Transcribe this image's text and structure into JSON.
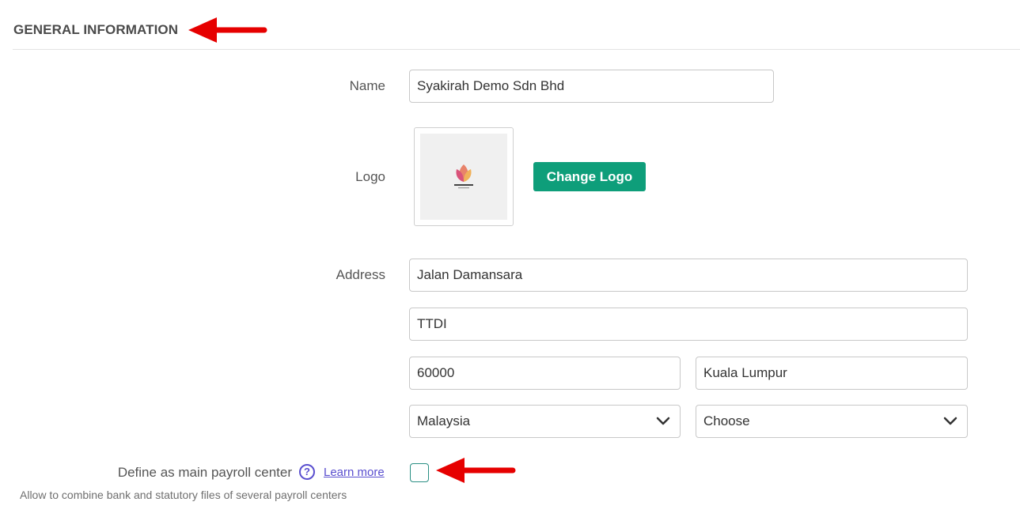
{
  "section": {
    "title": "GENERAL INFORMATION"
  },
  "form": {
    "name_label": "Name",
    "name_value": "Syakirah Demo Sdn Bhd",
    "logo_label": "Logo",
    "logo_text": "FLOWER LOGO",
    "change_logo_label": "Change Logo",
    "address_label": "Address",
    "address_line1": "Jalan Damansara",
    "address_line2": "TTDI",
    "postcode": "60000",
    "city": "Kuala Lumpur",
    "country_selected": "Malaysia",
    "state_selected": "Choose",
    "main_payroll_label": "Define as main payroll center",
    "help_symbol": "?",
    "learn_more": "Learn more",
    "main_payroll_hint": "Allow to combine bank and statutory files of several payroll centers",
    "main_payroll_checked": false
  },
  "colors": {
    "accent_button": "#0e9e7a",
    "link": "#5a4fcf",
    "checkbox_border": "#2a8f84",
    "annotation_arrow": "#e60000"
  },
  "icons": [
    "chevron-down-icon",
    "help-icon",
    "annotation-arrow-icon",
    "flower-logo-icon"
  ]
}
